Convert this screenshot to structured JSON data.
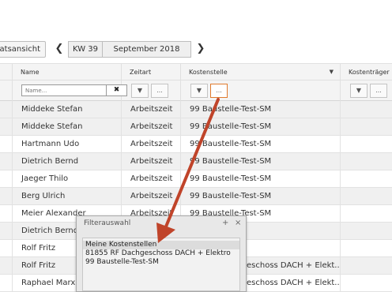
{
  "toolbar": {
    "month_view_label": "natsansicht",
    "prev_icon": "chevron-left-icon",
    "next_icon": "chevron-right-icon",
    "prev_glyph": "❮",
    "next_glyph": "❯",
    "week_label": "KW 39",
    "month_label": "September 2018"
  },
  "columns": {
    "name": "Name",
    "zeitart": "Zeitart",
    "kostenstelle": "Kostenstelle",
    "kostentraeger": "Kostenträger"
  },
  "filters": {
    "name_placeholder": "Name...",
    "clear_glyph": "✖",
    "filter_glyph": "▼",
    "more_glyph": "..."
  },
  "rows": [
    {
      "name": "Middeke Stefan",
      "zeitart": "Arbeitszeit",
      "kostenstelle": "99 Baustelle-Test-SM"
    },
    {
      "name": "Middeke Stefan",
      "zeitart": "Arbeitszeit",
      "kostenstelle": "99 Baustelle-Test-SM"
    },
    {
      "name": "Hartmann Udo",
      "zeitart": "Arbeitszeit",
      "kostenstelle": "99 Baustelle-Test-SM"
    },
    {
      "name": "Dietrich Bernd",
      "zeitart": "Arbeitszeit",
      "kostenstelle": "99 Baustelle-Test-SM"
    },
    {
      "name": "Jaeger Thilo",
      "zeitart": "Arbeitszeit",
      "kostenstelle": "99 Baustelle-Test-SM"
    },
    {
      "name": "Berg Ulrich",
      "zeitart": "Arbeitszeit",
      "kostenstelle": "99 Baustelle-Test-SM"
    },
    {
      "name": "Meier Alexander",
      "zeitart": "Arbeitszeit",
      "kostenstelle": "99 Baustelle-Test-SM"
    },
    {
      "name": "Dietrich Bernd",
      "zeitart": "",
      "kostenstelle": ""
    },
    {
      "name": "Rolf Fritz",
      "zeitart": "",
      "kostenstelle": ""
    },
    {
      "name": "Rolf Fritz",
      "zeitart": "",
      "kostenstelle": "eschoss DACH + Elekt..."
    },
    {
      "name": "Raphael Marx",
      "zeitart": "",
      "kostenstelle": "eschoss DACH + Elekt..."
    }
  ],
  "popup": {
    "title": "Filterauswahl",
    "plus_glyph": "+",
    "close_glyph": "×",
    "items": [
      "Meine Kostenstellen",
      "81855 RF Dachgeschoss DACH + Elektro",
      "99 Baustelle-Test-SM"
    ]
  },
  "colors": {
    "highlight_border": "#e07b2e",
    "annotation_arrow": "#c0442a"
  }
}
